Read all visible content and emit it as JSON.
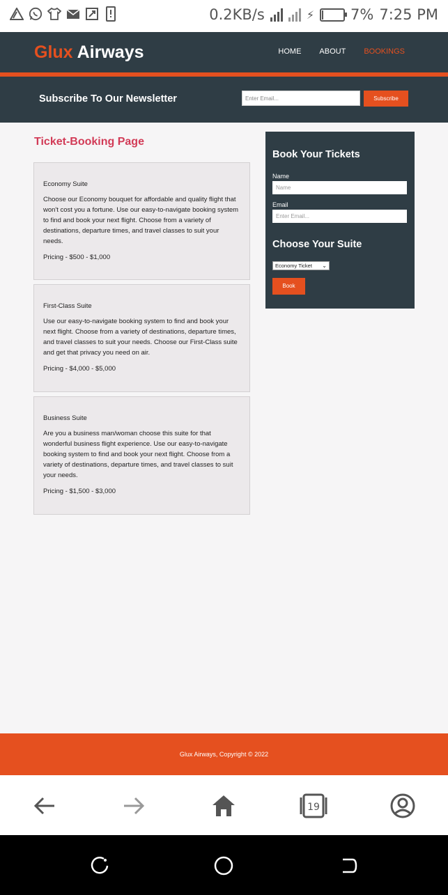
{
  "status_bar": {
    "net_speed": "0.2KB/s",
    "battery_percent": "7%",
    "battery_level": 0.07,
    "time": "7:25 PM",
    "left_icons": [
      "triangle-icon",
      "whatsapp-icon",
      "shirt-icon",
      "message-icon",
      "screenshot-icon",
      "sim-icon"
    ]
  },
  "header": {
    "logo_part1": "Glux",
    "logo_part2": "Airways",
    "nav": [
      "HOME",
      "ABOUT",
      "BOOKINGS"
    ],
    "active_nav": "BOOKINGS"
  },
  "newsletter": {
    "title": "Subscribe To Our Newsletter",
    "email_placeholder": "Enter Email...",
    "button": "Subscribe"
  },
  "main": {
    "page_title": "Ticket-Booking Page",
    "suites": [
      {
        "name": "Economy Suite",
        "description": "Choose our Economy bouquet for affordable and quality flight that won't cost you a fortune. Use our easy-to-navigate booking system to find and book your next flight. Choose from a variety of destinations, departure times, and travel classes to suit your needs.",
        "pricing": "Pricing - $500 - $1,000"
      },
      {
        "name": "First-Class Suite",
        "description": "Use our easy-to-navigate booking system to find and book your next flight. Choose from a variety of destinations, departure times, and travel classes to suit your needs. Choose our First-Class suite and get that privacy you need on air.",
        "pricing": "Pricing - $4,000 - $5,000"
      },
      {
        "name": "Business Suite",
        "description": "Are you a business man/woman choose this suite for that wonderful business flight experience. Use our easy-to-navigate booking system to find and book your next flight. Choose from a variety of destinations, departure times, and travel classes to suit your needs.",
        "pricing": "Pricing - $1,500 - $3,000"
      }
    ]
  },
  "booking_form": {
    "title": "Book Your Tickets",
    "name_label": "Name",
    "name_placeholder": "Name",
    "email_label": "Email",
    "email_placeholder": "Enter Email...",
    "suite_title": "Choose Your Suite",
    "suite_selected": "Economy Ticket",
    "book_button": "Book"
  },
  "footer": {
    "copyright": "Glux Airways, Copyright © 2022"
  },
  "browser_bar": {
    "tab_count": "19",
    "buttons": [
      "back-arrow-icon",
      "forward-arrow-icon",
      "home-icon",
      "tabs-icon",
      "account-icon"
    ]
  },
  "system_nav": {
    "buttons": [
      "recents-icon",
      "home-circle-icon",
      "back-icon"
    ]
  },
  "colors": {
    "accent": "#e5501f",
    "dark": "#2f3d45",
    "title_red": "#d23b57",
    "card_bg": "#ece9eb",
    "page_bg": "#f6f5f6"
  }
}
